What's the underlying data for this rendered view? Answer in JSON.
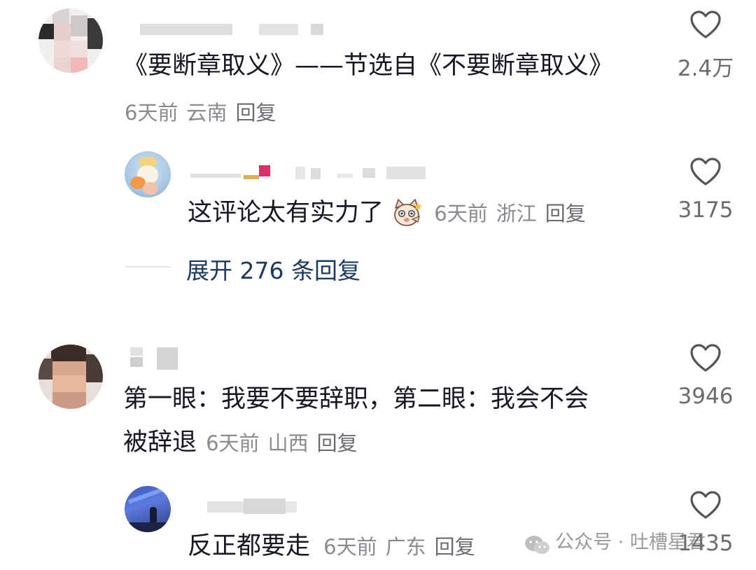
{
  "comments": [
    {
      "text": "《要断章取义》——节选自《不要断章取义》",
      "time": "6天前",
      "location": "云南",
      "reply_label": "回复",
      "likes": "2.4万",
      "replies": [
        {
          "text": "这评论太有实力了",
          "emoji": "cat-face-emoji",
          "time": "6天前",
          "location": "浙江",
          "reply_label": "回复",
          "likes": "3175"
        }
      ],
      "expand_label": "展开 276 条回复"
    },
    {
      "text_line1": "第一眼：我要不要辞职，第二眼：我会不会",
      "text_line2": "被辞退",
      "time": "6天前",
      "location": "山西",
      "reply_label": "回复",
      "likes": "3946",
      "replies": [
        {
          "text": "反正都要走",
          "time": "6天前",
          "location": "广东",
          "reply_label": "回复",
          "likes": "1435"
        }
      ]
    }
  ],
  "watermark": "公众号 · 吐槽星君",
  "colors": {
    "text": "#161823",
    "meta": "#8a8b91",
    "expand": "#1d3a63",
    "heart_stroke": "#555555"
  }
}
